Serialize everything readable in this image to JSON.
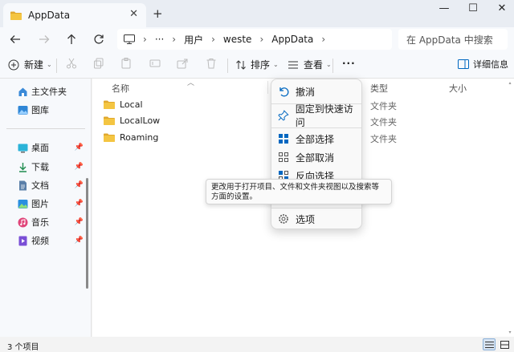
{
  "window": {
    "tab_title": "AppData",
    "close_tab": "✕",
    "new_tab": "+",
    "minimize": "—",
    "maximize": "☐",
    "close": "✕"
  },
  "address": {
    "more": "···",
    "path": [
      "用户",
      "weste",
      "AppData"
    ],
    "search_placeholder": "在 AppData 中搜索"
  },
  "toolbar": {
    "new_label": "新建",
    "sort_label": "排序",
    "view_label": "查看",
    "more_label": "···",
    "details_label": "详细信息"
  },
  "sidebar": {
    "items": [
      {
        "label": "主文件夹",
        "icon": "home-icon",
        "pinned": false
      },
      {
        "label": "图库",
        "icon": "gallery-icon",
        "pinned": false
      },
      {
        "label": "桌面",
        "icon": "desktop-icon",
        "pinned": true
      },
      {
        "label": "下载",
        "icon": "download-icon",
        "pinned": true
      },
      {
        "label": "文档",
        "icon": "document-icon",
        "pinned": true
      },
      {
        "label": "图片",
        "icon": "picture-icon",
        "pinned": true
      },
      {
        "label": "音乐",
        "icon": "music-icon",
        "pinned": true
      },
      {
        "label": "视频",
        "icon": "video-icon",
        "pinned": true
      }
    ]
  },
  "columns": {
    "name": "名称",
    "type": "类型",
    "size": "大小"
  },
  "files": [
    {
      "name": "Local",
      "type": "文件夹"
    },
    {
      "name": "LocalLow",
      "type": "文件夹"
    },
    {
      "name": "Roaming",
      "type": "文件夹"
    }
  ],
  "menu": {
    "undo": "撤消",
    "pin_quick": "固定到快速访问",
    "select_all": "全部选择",
    "select_none": "全部取消",
    "invert": "反向选择",
    "options": "选项"
  },
  "tooltip": {
    "text": "更改用于打开项目、文件和文件夹视图以及搜索等方面的设置。"
  },
  "status": {
    "count": "3 个项目"
  },
  "colors": {
    "accent": "#0067c0",
    "folder": "#f4c542",
    "folder_dark": "#e0a82e"
  }
}
